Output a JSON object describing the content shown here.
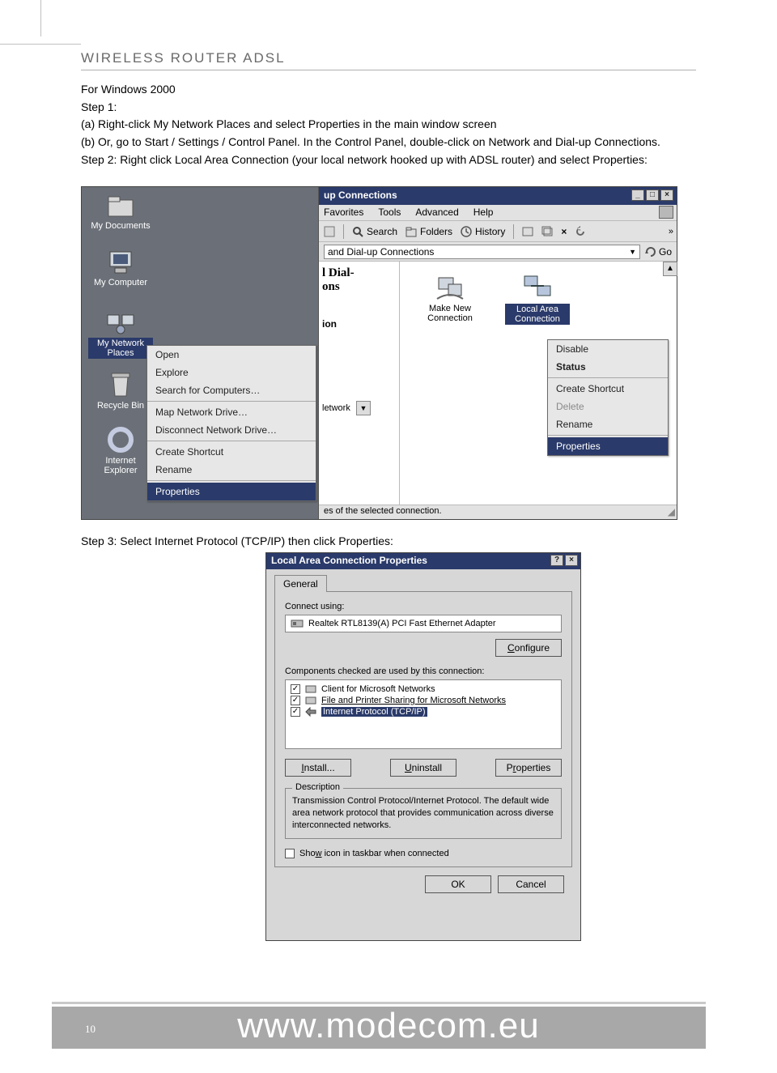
{
  "header": {
    "title": "WIRELESS ROUTER ADSL"
  },
  "intro": {
    "l1": "For Windows 2000",
    "l2": "Step 1:",
    "l3": "(a) Right-click My Network Places and select Properties in the main window screen",
    "l4": "(b) Or, go to Start / Settings / Control Panel. In the Control Panel, double-click on Network and Dial-up Connections.",
    "l5": "Step 2: Right click Local Area Connection (your local network hooked up with ADSL router) and select Properties:"
  },
  "step3": "Step 3: Select Internet Protocol (TCP/IP) then click Properties:",
  "desktop": {
    "mydocs": "My Documents",
    "mycomp": "My Computer",
    "mynet": "My Network Places",
    "recycle": "Recycle Bin",
    "ie": "Internet Explorer"
  },
  "ctxA": {
    "open": "Open",
    "explore": "Explore",
    "search": "Search for Computers…",
    "map": "Map Network Drive…",
    "disc": "Disconnect Network Drive…",
    "shortcut": "Create Shortcut",
    "rename": "Rename",
    "properties": "Properties"
  },
  "explorer": {
    "title": "up Connections",
    "menus": {
      "fav": "Favorites",
      "tools": "Tools",
      "adv": "Advanced",
      "help": "Help"
    },
    "toolbar": {
      "search": "Search",
      "folders": "Folders",
      "history": "History"
    },
    "address_text": "and Dial-up Connections",
    "go": "Go",
    "left_hd1": "l Dial-",
    "left_hd2": "ons",
    "left_sub": "ion",
    "left_net": "letwork",
    "conn_make": "Make New Connection",
    "conn_lac": "Local Area Connection",
    "status": "es of the selected connection."
  },
  "ctxB": {
    "disable": "Disable",
    "status": "Status",
    "shortcut": "Create Shortcut",
    "delete": "Delete",
    "rename": "Rename",
    "properties": "Properties"
  },
  "dialog": {
    "title": "Local Area Connection Properties",
    "tab_general": "General",
    "connect_using": "Connect using:",
    "adapter": "Realtek RTL8139(A) PCI Fast Ethernet Adapter",
    "configure": "Configure",
    "components_label": "Components checked are used by this connection:",
    "c1": "Client for Microsoft Networks",
    "c2": "File and Printer Sharing for Microsoft Networks",
    "c3": "Internet Protocol (TCP/IP)",
    "install": "Install...",
    "uninstall": "Uninstall",
    "properties": "Properties",
    "desc_hd": "Description",
    "desc": "Transmission Control Protocol/Internet Protocol. The default wide area network protocol that provides communication across diverse interconnected networks.",
    "show_icon": "Show icon in taskbar when connected",
    "ok": "OK",
    "cancel": "Cancel"
  },
  "footer": {
    "page": "10",
    "url": "www.modecom.eu"
  }
}
